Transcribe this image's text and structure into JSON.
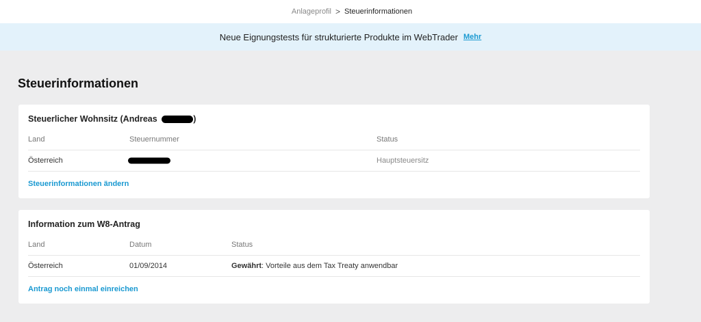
{
  "breadcrumb": {
    "parent": "Anlageprofil",
    "separator": ">",
    "current": "Steuerinformationen"
  },
  "banner": {
    "text": "Neue Eignungstests für strukturierte Produkte im WebTrader",
    "link": "Mehr"
  },
  "page_title": "Steuerinformationen",
  "residence_card": {
    "title": "Steuerlicher Wohnsitz (Andreas",
    "title_suffix": ")",
    "columns": [
      "Land",
      "Steuernummer",
      "Status"
    ],
    "row": {
      "land": "Österreich",
      "status": "Hauptsteuersitz"
    },
    "link": "Steuerinformationen ändern"
  },
  "w8_card": {
    "title": "Information zum W8-Antrag",
    "columns": [
      "Land",
      "Datum",
      "Status"
    ],
    "row": {
      "land": "Österreich",
      "datum": "01/09/2014",
      "status_bold": "Gewährt",
      "status_rest": ": Vorteile aus dem Tax Treaty anwendbar"
    },
    "link": "Antrag noch einmal einreichen"
  },
  "colors": {
    "accent": "#1a99d1",
    "banner_bg": "#e3f2fb",
    "page_bg": "#ededee"
  }
}
